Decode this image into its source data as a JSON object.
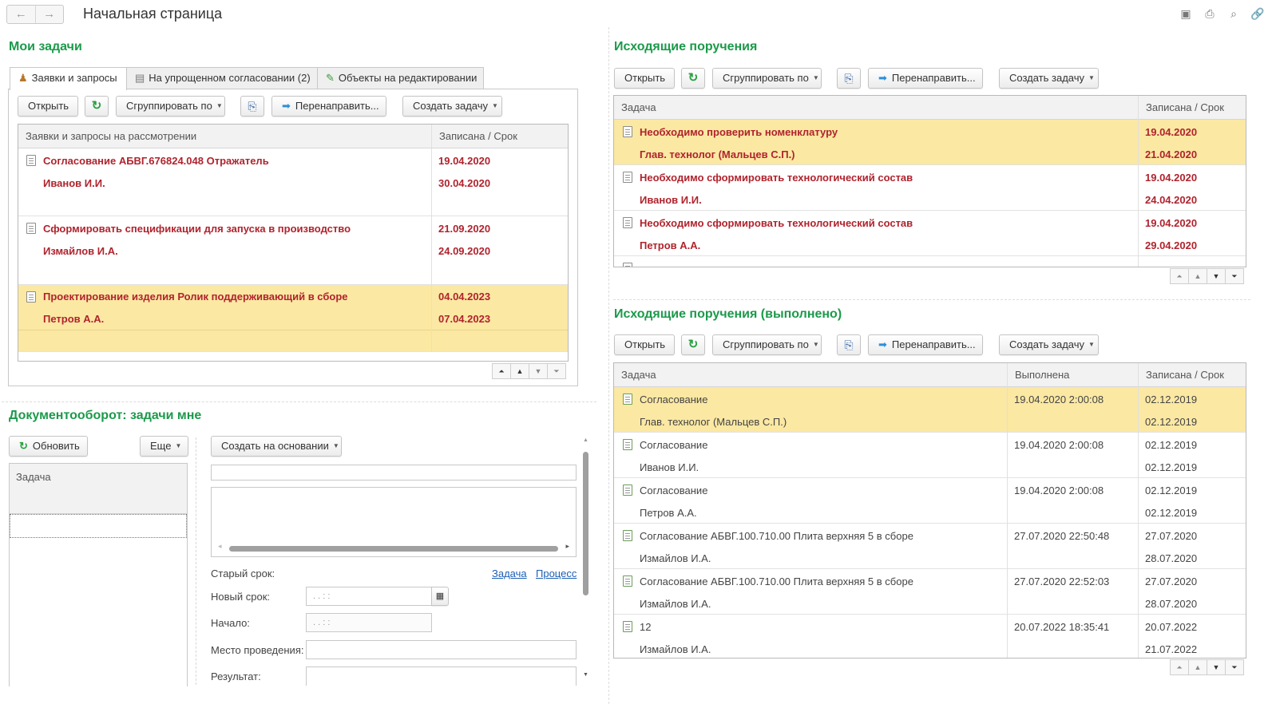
{
  "window": {
    "title": "Начальная страница",
    "nav_back": "←",
    "nav_forward": "→",
    "top_icons": [
      "save-icon",
      "print-icon",
      "preview-icon",
      "link-icon"
    ]
  },
  "my_tasks": {
    "title": "Мои задачи",
    "tabs": [
      {
        "label": "Заявки и запросы",
        "icon": "users-icon",
        "active": true
      },
      {
        "label": "На упрощенном согласовании (2)",
        "icon": "document-icon",
        "active": false
      },
      {
        "label": "Объекты на редактировании",
        "icon": "pencil-icon",
        "active": false
      }
    ],
    "toolbar": {
      "open": "Открыть",
      "group_by": "Сгруппировать по",
      "redirect": "Перенаправить...",
      "create_task": "Создать задачу"
    },
    "columns": [
      "Заявки и запросы на рассмотрении",
      "Записана / Срок"
    ],
    "rows": [
      {
        "title": "Согласование АБВГ.676824.048 Отражатель",
        "person": "Иванов И.И.",
        "date1": "19.04.2020",
        "date2": "30.04.2020",
        "selected": false
      },
      {
        "title": "Сформировать спецификации для запуска в производство",
        "person": "Измайлов И.А.",
        "date1": "21.09.2020",
        "date2": "24.09.2020",
        "selected": false
      },
      {
        "title": "Проектирование изделия Ролик поддерживающий в сборе",
        "person": "Петров А.А.",
        "date1": "04.04.2023",
        "date2": "07.04.2023",
        "selected": true
      }
    ]
  },
  "docflow": {
    "title": "Документооборот: задачи мне",
    "refresh": "Обновить",
    "more": "Еще",
    "create_based": "Создать на основании",
    "list_header": "Задача",
    "old_deadline": "Старый срок:",
    "task_link": "Задача",
    "process_link": "Процесс",
    "new_deadline": "Новый срок:",
    "start": "Начало:",
    "place": "Место проведения:",
    "result": "Результат:",
    "datetime_placeholder": ".  .       :  :"
  },
  "outgoing": {
    "title": "Исходящие поручения",
    "toolbar": {
      "open": "Открыть",
      "group_by": "Сгруппировать по",
      "redirect": "Перенаправить...",
      "create_task": "Создать задачу"
    },
    "columns": [
      "Задача",
      "Записана / Срок"
    ],
    "rows": [
      {
        "title": "Необходимо проверить номенклатуру",
        "person": "Глав. технолог (Мальцев С.П.)",
        "date1": "19.04.2020",
        "date2": "21.04.2020",
        "selected": true
      },
      {
        "title": "Необходимо сформировать технологический состав",
        "person": "Иванов И.И.",
        "date1": "19.04.2020",
        "date2": "24.04.2020",
        "selected": false
      },
      {
        "title": "Необходимо сформировать технологический состав",
        "person": "Петров А.А.",
        "date1": "19.04.2020",
        "date2": "29.04.2020",
        "selected": false
      }
    ]
  },
  "outgoing_done": {
    "title": "Исходящие поручения (выполнено)",
    "toolbar": {
      "open": "Открыть",
      "group_by": "Сгруппировать по",
      "redirect": "Перенаправить...",
      "create_task": "Создать задачу"
    },
    "columns": [
      "Задача",
      "Выполнена",
      "Записана / Срок"
    ],
    "rows": [
      {
        "title": "Согласование",
        "person": "Глав. технолог (Мальцев С.П.)",
        "done": "19.04.2020 2:00:08",
        "date1": "02.12.2019",
        "date2": "02.12.2019",
        "selected": true
      },
      {
        "title": "Согласование",
        "person": "Иванов И.И.",
        "done": "19.04.2020 2:00:08",
        "date1": "02.12.2019",
        "date2": "02.12.2019",
        "selected": false
      },
      {
        "title": "Согласование",
        "person": "Петров А.А.",
        "done": "19.04.2020 2:00:08",
        "date1": "02.12.2019",
        "date2": "02.12.2019",
        "selected": false
      },
      {
        "title": "Согласование АБВГ.100.710.00 Плита верхняя 5 в сборе",
        "person": "Измайлов И.А.",
        "done": "27.07.2020 22:50:48",
        "date1": "27.07.2020",
        "date2": "28.07.2020",
        "selected": false
      },
      {
        "title": "Согласование АБВГ.100.710.00 Плита верхняя 5 в сборе",
        "person": "Измайлов И.А.",
        "done": "27.07.2020 22:52:03",
        "date1": "27.07.2020",
        "date2": "28.07.2020",
        "selected": false
      },
      {
        "title": "12",
        "person": "Измайлов И.А.",
        "done": "20.07.2022 18:35:41",
        "date1": "20.07.2022",
        "date2": "21.07.2022",
        "selected": false
      }
    ]
  }
}
